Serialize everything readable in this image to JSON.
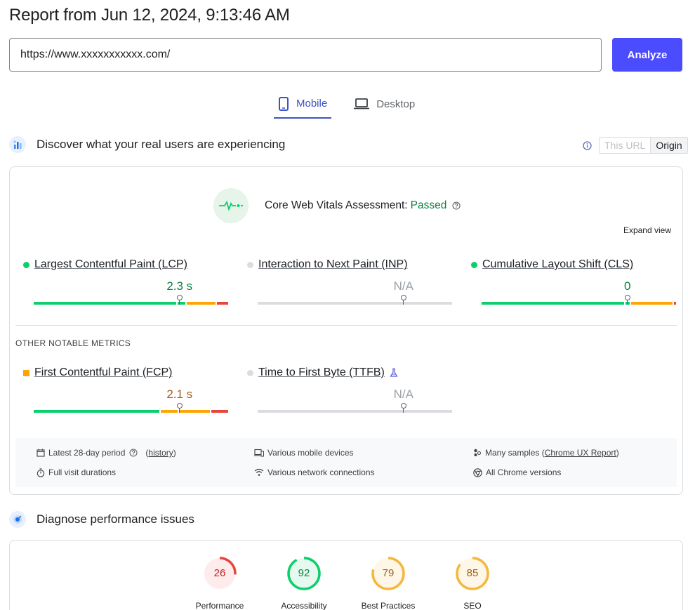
{
  "header": {
    "title": "Report from Jun 12, 2024, 9:13:46 AM"
  },
  "search": {
    "url_value": "https://www.xxxxxxxxxxx.com/",
    "analyze_label": "Analyze"
  },
  "tabs": [
    {
      "label": "Mobile",
      "icon": "smartphone-icon",
      "active": true
    },
    {
      "label": "Desktop",
      "icon": "laptop-icon",
      "active": false
    }
  ],
  "field_data": {
    "title": "Discover what your real users are experiencing",
    "toggle": {
      "this_url": "This URL",
      "origin": "Origin",
      "selected": "Origin"
    },
    "assessment_label": "Core Web Vitals Assessment:",
    "assessment_status": "Passed",
    "expand_label": "Expand view",
    "metrics": [
      {
        "name": "Largest Contentful Paint (LCP)",
        "value": "2.3 s",
        "status": "good",
        "marker": 0.75,
        "segments": [
          0.75,
          0.04,
          0.15,
          0.06
        ]
      },
      {
        "name": "Interaction to Next Paint (INP)",
        "value": "N/A",
        "status": "none",
        "marker": 0.75
      },
      {
        "name": "Cumulative Layout Shift (CLS)",
        "value": "0",
        "status": "good",
        "marker": 0.75,
        "segments": [
          0.75,
          0.02,
          0.22,
          0.01
        ]
      }
    ],
    "other_label": "OTHER NOTABLE METRICS",
    "other_metrics": [
      {
        "name": "First Contentful Paint (FCP)",
        "value": "2.1 s",
        "status": "average",
        "marker": 0.75,
        "segments": [
          0.66,
          0.09,
          0.16,
          0.09
        ]
      },
      {
        "name": "Time to First Byte (TTFB)",
        "value": "N/A",
        "status": "none",
        "marker": 0.75,
        "experimental": true
      }
    ],
    "info": {
      "period": "Latest 28-day period",
      "history": "history",
      "devices": "Various mobile devices",
      "samples_prefix": "Many samples (",
      "samples_link": "Chrome UX Report",
      "samples_suffix": ")",
      "durations": "Full visit durations",
      "network": "Various network connections",
      "chrome": "All Chrome versions"
    }
  },
  "diagnose": {
    "title": "Diagnose performance issues",
    "scores": [
      {
        "label": "Performance",
        "score": 26,
        "color": "#e8453c"
      },
      {
        "label": "Accessibility",
        "score": 92,
        "color": "#0cce6b"
      },
      {
        "label": "Best Practices",
        "score": 79,
        "color": "#f4b73e"
      },
      {
        "label": "SEO",
        "score": 85,
        "color": "#f4b73e"
      }
    ]
  },
  "colors": {
    "accent": "#4c4cff",
    "good": "#0cce6b",
    "good_text": "#0b8043",
    "average": "#ffa400",
    "average_text": "#a0611a",
    "poor": "#e8453c",
    "na": "#dadce0"
  }
}
